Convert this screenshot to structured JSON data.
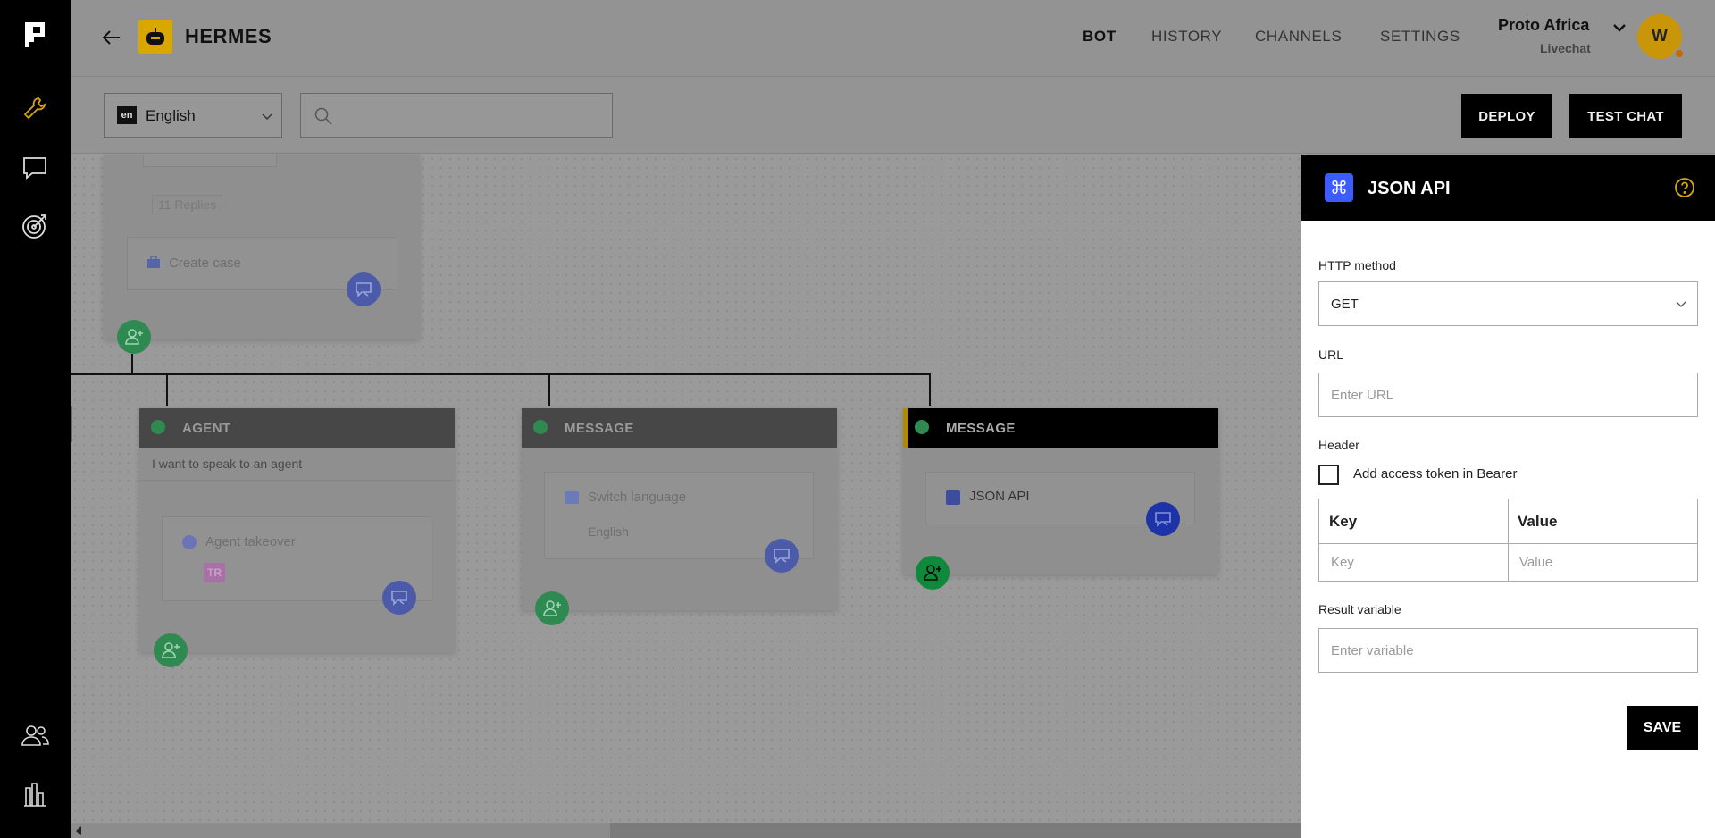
{
  "header": {
    "bot_name": "HERMES",
    "nav": [
      "BOT",
      "HISTORY",
      "CHANNELS",
      "SETTINGS"
    ],
    "active_nav": "BOT",
    "org_name": "Proto Africa",
    "org_sub": "Livechat",
    "avatar_letter": "W"
  },
  "toolbar": {
    "lang_code": "en",
    "lang_label": "English",
    "search_value": "",
    "deploy_label": "DEPLOY",
    "test_chat_label": "TEST CHAT"
  },
  "canvas": {
    "top_node": {
      "replies_text": "11 Replies",
      "action_label": "Create case"
    },
    "nodes": [
      {
        "type": "AGENT",
        "subtitle": "I want to speak to an agent",
        "action_label": "Agent takeover",
        "tag": "TR"
      },
      {
        "type": "MESSAGE",
        "action_label": "Switch language",
        "action_sub": "English"
      },
      {
        "type": "MESSAGE",
        "action_label": "JSON API"
      }
    ]
  },
  "panel": {
    "title": "JSON API",
    "http_method_label": "HTTP method",
    "http_method_value": "GET",
    "url_label": "URL",
    "url_placeholder": "Enter URL",
    "header_label": "Header",
    "bearer_checkbox_label": "Add access token in Bearer",
    "bearer_checked": false,
    "kv_key_header": "Key",
    "kv_value_header": "Value",
    "kv_key_placeholder": "Key",
    "kv_value_placeholder": "Value",
    "result_label": "Result variable",
    "result_placeholder": "Enter variable",
    "save_label": "SAVE"
  },
  "colors": {
    "accent_blue": "#3d5cff",
    "brand_yellow": "#d9a800",
    "success_green": "#2f8a52"
  }
}
